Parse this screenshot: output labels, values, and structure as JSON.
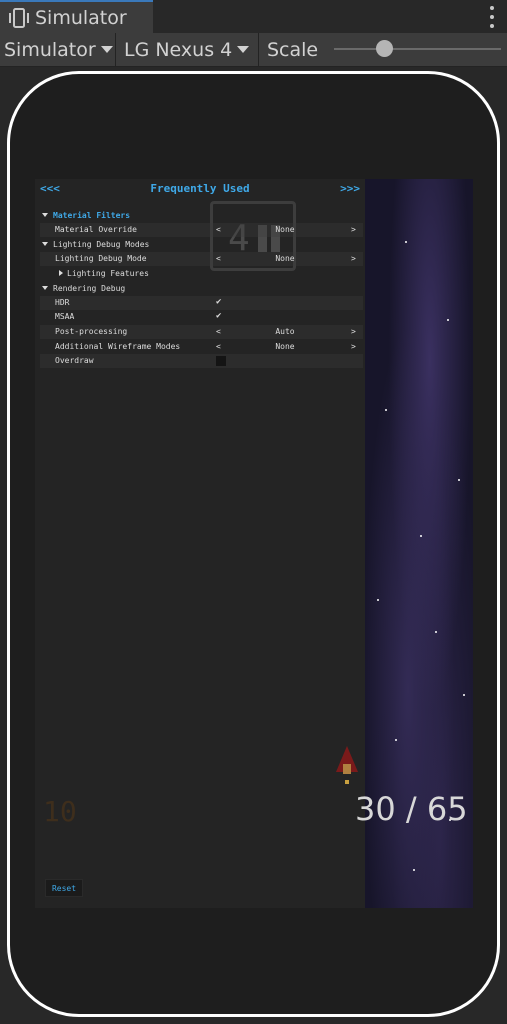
{
  "window": {
    "tab_title": "Simulator"
  },
  "toolbar": {
    "mode_label": "Simulator",
    "device_label": "LG Nexus 4",
    "scale_label": "Scale",
    "scale_value": 0.3
  },
  "game": {
    "pause_number": "4",
    "hud_left": "10",
    "hud_right": "30 / 65"
  },
  "debug_panel": {
    "nav_prev": "<<<",
    "nav_next": ">>>",
    "title": "Frequently Used",
    "rows": [
      {
        "type": "section",
        "label": "Material Filters"
      },
      {
        "type": "enum",
        "label": "Material Override",
        "value": "None",
        "prev": "<",
        "next": ">"
      },
      {
        "type": "section",
        "label": "Lighting Debug Modes"
      },
      {
        "type": "enum",
        "label": "Lighting Debug Mode",
        "value": "None",
        "prev": "<",
        "next": ">"
      },
      {
        "type": "foldout",
        "label": "Lighting Features"
      },
      {
        "type": "section",
        "label": "Rendering Debug"
      },
      {
        "type": "toggle",
        "label": "HDR",
        "checked": true,
        "mark": "✔"
      },
      {
        "type": "toggle",
        "label": "MSAA",
        "checked": true,
        "mark": "✔"
      },
      {
        "type": "enum",
        "label": "Post-processing",
        "value": "Auto",
        "prev": "<",
        "next": ">"
      },
      {
        "type": "enum",
        "label": "Additional Wireframe Modes",
        "value": "None",
        "prev": "<",
        "next": ">"
      },
      {
        "type": "toggle",
        "label": "Overdraw",
        "checked": false
      }
    ],
    "reset_label": "Reset"
  },
  "colors": {
    "accent": "#3fa9e8",
    "panel_bg": "#242424",
    "device_outline": "#ffffff",
    "editor_bg": "#282828"
  }
}
